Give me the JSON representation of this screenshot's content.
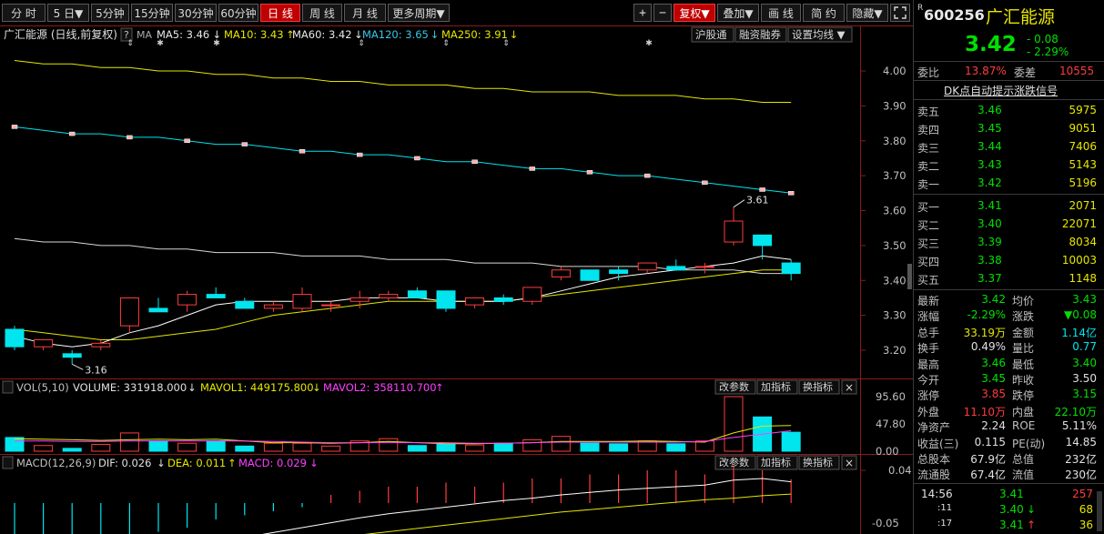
{
  "toolbar": {
    "periods": [
      "分 时",
      "5 日▼",
      "5分钟",
      "15分钟",
      "30分钟",
      "60分钟",
      "日 线",
      "周 线",
      "月 线",
      "更多周期▼"
    ],
    "active_period": "日 线",
    "tools": [
      "+",
      "−",
      "复权▼",
      "叠加▼",
      "画 线",
      "简 约",
      "隐藏▼"
    ],
    "active_tool": "复权▼"
  },
  "indicator_bar": {
    "title": "广汇能源 (日线,前复权)",
    "question": "?",
    "ma_label": "MA",
    "ma": [
      {
        "text": "MA5: 3.46",
        "arrow": "↓",
        "color": "#e8e8e8"
      },
      {
        "text": "MA10: 3.43",
        "arrow": "↑",
        "color": "#e6e600"
      },
      {
        "text": "MA60: 3.42",
        "arrow": "↓",
        "color": "#e8e8e8"
      },
      {
        "text": "MA120: 3.65",
        "arrow": "↓",
        "color": "#33c9e8"
      },
      {
        "text": "MA250: 3.91",
        "arrow": "↓",
        "color": "#e6e600"
      }
    ],
    "buttons": [
      "沪股通",
      "融资融券",
      "设置均线 ▼"
    ]
  },
  "price_axis": [
    "4.00",
    "3.90",
    "3.80",
    "3.70",
    "3.60",
    "3.50",
    "3.40",
    "3.30",
    "3.20"
  ],
  "annotations": {
    "high": "3.61",
    "low": "3.16"
  },
  "volume_panel": {
    "label": "VOL(5,10)",
    "volume": "VOLUME: 331918.000",
    "volume_arrow": "↓",
    "mavol1": "MAVOL1: 449175.800",
    "mavol1_arrow": "↓",
    "mavol2": "MAVOL2: 358110.700",
    "mavol2_arrow": "↑",
    "axis": [
      "95.60",
      "47.80",
      "0.00"
    ],
    "buttons": [
      "改参数",
      "加指标",
      "换指标",
      "×"
    ]
  },
  "macd_panel": {
    "label": "MACD(12,26,9)",
    "dif": "DIF: 0.026",
    "dif_arrow": "↓",
    "dea": "DEA: 0.011",
    "dea_arrow": "↑",
    "macd": "MACD: 0.029",
    "macd_arrow": "↓",
    "axis": [
      "0.04",
      "-0.05"
    ],
    "buttons": [
      "改参数",
      "加指标",
      "换指标",
      "×"
    ]
  },
  "chart_data": {
    "type": "candlestick",
    "ylim": [
      3.15,
      4.05
    ],
    "candles": [
      {
        "o": 3.26,
        "h": 3.27,
        "l": 3.2,
        "c": 3.21
      },
      {
        "o": 3.21,
        "h": 3.23,
        "l": 3.2,
        "c": 3.23
      },
      {
        "o": 3.19,
        "h": 3.2,
        "l": 3.16,
        "c": 3.18
      },
      {
        "o": 3.21,
        "h": 3.23,
        "l": 3.2,
        "c": 3.22
      },
      {
        "o": 3.27,
        "h": 3.35,
        "l": 3.25,
        "c": 3.35
      },
      {
        "o": 3.32,
        "h": 3.35,
        "l": 3.31,
        "c": 3.31
      },
      {
        "o": 3.33,
        "h": 3.37,
        "l": 3.31,
        "c": 3.36
      },
      {
        "o": 3.36,
        "h": 3.38,
        "l": 3.35,
        "c": 3.35
      },
      {
        "o": 3.34,
        "h": 3.35,
        "l": 3.32,
        "c": 3.32
      },
      {
        "o": 3.32,
        "h": 3.34,
        "l": 3.31,
        "c": 3.33
      },
      {
        "o": 3.32,
        "h": 3.38,
        "l": 3.31,
        "c": 3.36
      },
      {
        "o": 3.33,
        "h": 3.34,
        "l": 3.31,
        "c": 3.33
      },
      {
        "o": 3.34,
        "h": 3.37,
        "l": 3.32,
        "c": 3.35
      },
      {
        "o": 3.35,
        "h": 3.37,
        "l": 3.34,
        "c": 3.36
      },
      {
        "o": 3.37,
        "h": 3.38,
        "l": 3.35,
        "c": 3.35
      },
      {
        "o": 3.37,
        "h": 3.37,
        "l": 3.31,
        "c": 3.32
      },
      {
        "o": 3.33,
        "h": 3.35,
        "l": 3.32,
        "c": 3.35
      },
      {
        "o": 3.35,
        "h": 3.36,
        "l": 3.33,
        "c": 3.34
      },
      {
        "o": 3.34,
        "h": 3.38,
        "l": 3.33,
        "c": 3.38
      },
      {
        "o": 3.41,
        "h": 3.44,
        "l": 3.4,
        "c": 3.43
      },
      {
        "o": 3.43,
        "h": 3.43,
        "l": 3.4,
        "c": 3.4
      },
      {
        "o": 3.43,
        "h": 3.44,
        "l": 3.4,
        "c": 3.42
      },
      {
        "o": 3.43,
        "h": 3.45,
        "l": 3.42,
        "c": 3.45
      },
      {
        "o": 3.44,
        "h": 3.46,
        "l": 3.43,
        "c": 3.43
      },
      {
        "o": 3.44,
        "h": 3.45,
        "l": 3.42,
        "c": 3.44
      },
      {
        "o": 3.51,
        "h": 3.61,
        "l": 3.5,
        "c": 3.57
      },
      {
        "o": 3.53,
        "h": 3.53,
        "l": 3.46,
        "c": 3.5
      },
      {
        "o": 3.45,
        "h": 3.46,
        "l": 3.4,
        "c": 3.42
      }
    ],
    "ma5": [
      3.24,
      3.22,
      3.21,
      3.22,
      3.25,
      3.27,
      3.3,
      3.33,
      3.34,
      3.34,
      3.34,
      3.34,
      3.35,
      3.35,
      3.35,
      3.34,
      3.34,
      3.34,
      3.35,
      3.37,
      3.39,
      3.41,
      3.42,
      3.43,
      3.44,
      3.45,
      3.47,
      3.46
    ],
    "ma10": [
      3.26,
      3.25,
      3.24,
      3.23,
      3.23,
      3.24,
      3.25,
      3.26,
      3.28,
      3.3,
      3.31,
      3.32,
      3.33,
      3.34,
      3.34,
      3.34,
      3.34,
      3.34,
      3.35,
      3.36,
      3.37,
      3.38,
      3.39,
      3.4,
      3.41,
      3.42,
      3.43,
      3.43
    ],
    "ma60": [
      3.52,
      3.51,
      3.51,
      3.5,
      3.5,
      3.49,
      3.49,
      3.48,
      3.48,
      3.48,
      3.47,
      3.47,
      3.47,
      3.46,
      3.46,
      3.46,
      3.45,
      3.45,
      3.45,
      3.44,
      3.44,
      3.44,
      3.44,
      3.43,
      3.43,
      3.43,
      3.42,
      3.42
    ],
    "ma120": [
      3.84,
      3.83,
      3.82,
      3.82,
      3.81,
      3.81,
      3.8,
      3.79,
      3.79,
      3.78,
      3.77,
      3.77,
      3.76,
      3.76,
      3.75,
      3.74,
      3.74,
      3.73,
      3.72,
      3.72,
      3.71,
      3.7,
      3.7,
      3.69,
      3.68,
      3.67,
      3.66,
      3.65
    ],
    "ma250": [
      4.03,
      4.02,
      4.02,
      4.01,
      4.01,
      4.0,
      4.0,
      3.99,
      3.99,
      3.98,
      3.98,
      3.97,
      3.97,
      3.96,
      3.96,
      3.96,
      3.95,
      3.95,
      3.94,
      3.94,
      3.94,
      3.93,
      3.93,
      3.93,
      3.92,
      3.92,
      3.91,
      3.91
    ],
    "volume": [
      24,
      10,
      5,
      12,
      32,
      18,
      14,
      18,
      9,
      14,
      14,
      9,
      18,
      22,
      10,
      12,
      11,
      14,
      20,
      26,
      14,
      13,
      18,
      13,
      18,
      95.6,
      60,
      33.2
    ],
    "mavol1": [
      22,
      21,
      20,
      19,
      20,
      21,
      20,
      21,
      18,
      15,
      15,
      14,
      15,
      17,
      15,
      13,
      13,
      14,
      15,
      17,
      17,
      17,
      18,
      17,
      16,
      32,
      44,
      44.9
    ],
    "mavol2": [
      18,
      18,
      17,
      17,
      18,
      18,
      18,
      18,
      18,
      17,
      16,
      15,
      15,
      15,
      15,
      15,
      14,
      14,
      15,
      16,
      16,
      16,
      16,
      16,
      17,
      24,
      30,
      35.8
    ],
    "macd_hist": [
      -0.06,
      -0.06,
      -0.055,
      -0.05,
      -0.045,
      -0.035,
      -0.03,
      -0.02,
      -0.015,
      -0.01,
      -0.005,
      0.01,
      0.015,
      0.02,
      0.02,
      0.025,
      0.02,
      0.025,
      0.03,
      0.03,
      0.035,
      0.035,
      0.04,
      0.04,
      0.035,
      0.045,
      0.04,
      0.029
    ],
    "dif": [
      -0.06,
      -0.062,
      -0.065,
      -0.066,
      -0.064,
      -0.06,
      -0.055,
      -0.048,
      -0.042,
      -0.036,
      -0.03,
      -0.024,
      -0.018,
      -0.013,
      -0.009,
      -0.005,
      -0.001,
      0.003,
      0.006,
      0.01,
      0.013,
      0.016,
      0.018,
      0.02,
      0.022,
      0.028,
      0.03,
      0.026
    ],
    "dea": [
      -0.04,
      -0.044,
      -0.048,
      -0.052,
      -0.055,
      -0.056,
      -0.056,
      -0.055,
      -0.053,
      -0.05,
      -0.047,
      -0.043,
      -0.039,
      -0.035,
      -0.031,
      -0.027,
      -0.023,
      -0.019,
      -0.015,
      -0.011,
      -0.008,
      -0.005,
      -0.002,
      0.001,
      0.004,
      0.006,
      0.009,
      0.011
    ]
  },
  "quote": {
    "code": "600256",
    "r_mark": "R",
    "name": "广汇能源",
    "price": "3.42",
    "change": "- 0.08",
    "change_pct": "- 2.29%",
    "weibi_label": "委比",
    "weibi": "13.87%",
    "weicha_label": "委差",
    "weicha": "10555",
    "signal": "DK点自动提示涨跌信号",
    "sell": [
      {
        "label": "卖五",
        "price": "3.46",
        "vol": "5975"
      },
      {
        "label": "卖四",
        "price": "3.45",
        "vol": "9051"
      },
      {
        "label": "卖三",
        "price": "3.44",
        "vol": "7406"
      },
      {
        "label": "卖二",
        "price": "3.43",
        "vol": "5143"
      },
      {
        "label": "卖一",
        "price": "3.42",
        "vol": "5196"
      }
    ],
    "buy": [
      {
        "label": "买一",
        "price": "3.41",
        "vol": "2071"
      },
      {
        "label": "买二",
        "price": "3.40",
        "vol": "22071"
      },
      {
        "label": "买三",
        "price": "3.39",
        "vol": "8034"
      },
      {
        "label": "买四",
        "price": "3.38",
        "vol": "10003"
      },
      {
        "label": "买五",
        "price": "3.37",
        "vol": "1148"
      }
    ],
    "stats": [
      [
        "最新",
        "3.42",
        "均价",
        "3.43"
      ],
      [
        "涨幅",
        "-2.29%",
        "涨跌",
        "▼0.08"
      ],
      [
        "总手",
        "33.19万",
        "金额",
        "1.14亿"
      ],
      [
        "换手",
        "0.49%",
        "量比",
        "0.77"
      ],
      [
        "最高",
        "3.46",
        "最低",
        "3.40"
      ],
      [
        "今开",
        "3.45",
        "昨收",
        "3.50"
      ],
      [
        "涨停",
        "3.85",
        "跌停",
        "3.15"
      ],
      [
        "外盘",
        "11.10万",
        "内盘",
        "22.10万"
      ],
      [
        "净资产",
        "2.24",
        "ROE",
        "5.11%"
      ],
      [
        "收益(三)",
        "0.115",
        "PE(动)",
        "14.85"
      ],
      [
        "总股本",
        "67.9亿",
        "总值",
        "232亿"
      ],
      [
        "流通股",
        "67.4亿",
        "流值",
        "230亿"
      ]
    ],
    "ticks": [
      {
        "time": "14:56",
        "price": "3.41",
        "vol": "257",
        "dir": ""
      },
      {
        "time": ":11",
        "price": "3.40",
        "vol": "68",
        "dir": "↓"
      },
      {
        "time": ":17",
        "price": "3.41",
        "vol": "36",
        "dir": "↑"
      }
    ],
    "colors": {
      "up": "#ff3c3c",
      "down": "#00e000",
      "cyan": "#00e5ee",
      "yellow": "#e6e600",
      "magenta": "#ff40ff"
    }
  }
}
